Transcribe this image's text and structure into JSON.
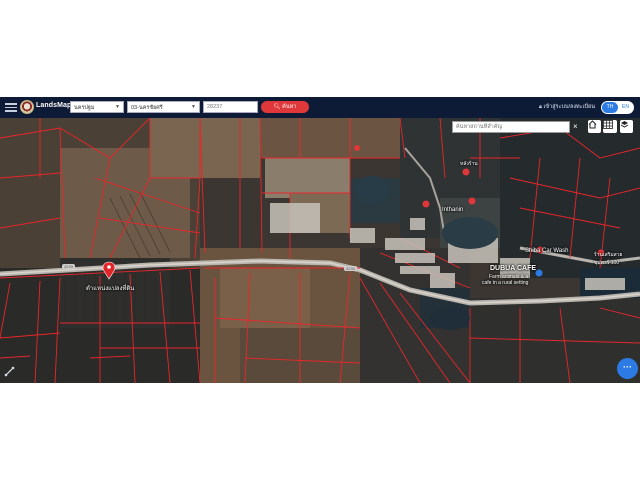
{
  "navbar": {
    "brand": "LandsMaps",
    "province": "นครปฐม",
    "district": "03-นครชัยศรี",
    "parcel_value": "28237",
    "search_label": "ค้นหา",
    "login_label": "เข้าสู่ระบบ/ลงทะเบียน",
    "lang_th": "TH",
    "lang_en": "EN"
  },
  "map": {
    "place_search_placeholder": "ค้นหาสถานที่สำคัญ",
    "close_glyph": "×",
    "more_glyph": "···",
    "pin_label": "ตำแหน่งแปลงที่ดิน",
    "labels": [
      {
        "text": "หลังร้าน",
        "style": "small"
      },
      {
        "text": "Inthanin",
        "style": ""
      },
      {
        "text": "Shiba Car Wash",
        "style": ""
      },
      {
        "text": "DUBUA CAFE",
        "style": "bold"
      },
      {
        "text": "Farm animals & a",
        "style": "small"
      },
      {
        "text": "cafe in a rural setting",
        "style": "small"
      },
      {
        "text": "ร้านเสริมสวย",
        "style": "small"
      },
      {
        "text": "ซุปตาร์ 100",
        "style": "small"
      }
    ],
    "road_badges": [
      "3233",
      "3233"
    ]
  },
  "colors": {
    "navbar_bg": "#0d1b36",
    "search_button": "#e0373a",
    "accent_blue": "#2c7be5",
    "parcel_line": "#e8262b"
  }
}
